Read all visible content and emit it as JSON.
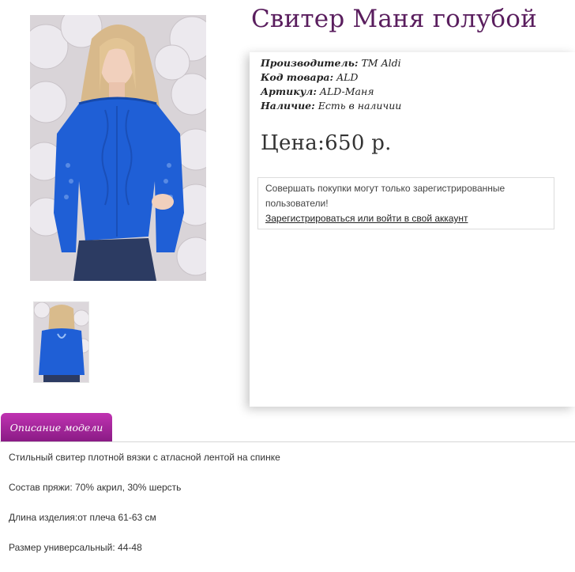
{
  "product": {
    "title": "Свитер Маня голубой",
    "manufacturer_key": "Производитель:",
    "manufacturer_value": "ТМ Aldi",
    "code_key": "Код товара:",
    "code_value": "ALD",
    "sku_key": "Артикул:",
    "sku_value": "ALD-Маня",
    "stock_key": "Наличие:",
    "stock_value": "Есть в наличии",
    "price": "Цена:650 р."
  },
  "notice": {
    "text": "Совершать покупки могут только зарегистрированные пользователи!",
    "link": "Зарегистрироваться или войти в свой аккаунт"
  },
  "tab": {
    "label": "Описание модели"
  },
  "description": [
    "Стильный свитер плотной вязки с атласной лентой на спинке",
    "Состав пряжи: 70% акрил, 30% шерсть",
    "Длина изделия:от плеча 61-63 см",
    "Размер универсальный: 44-48"
  ],
  "colors": {
    "title": "#5a1e5e",
    "tab_top": "#c033b2",
    "tab_bottom": "#8a1b85",
    "sweater": "#1f5fd6"
  }
}
